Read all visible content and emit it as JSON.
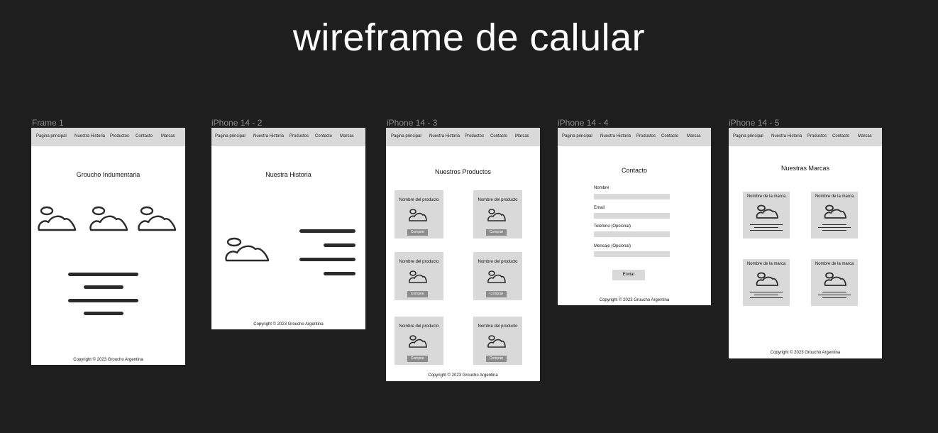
{
  "canvas_title": "wireframe de calular",
  "nav_items": [
    "Pagina principal",
    "Nuestra Historia",
    "Productos",
    "Contacto",
    "Marcas"
  ],
  "copyright": "Copyright © 2023 Groucho Argentina",
  "frames": {
    "f1": {
      "label": "Frame 1",
      "title": "Groucho Indumentaria"
    },
    "f2": {
      "label": "iPhone 14 - 2",
      "title": "Nuestra Historia"
    },
    "f3": {
      "label": "iPhone 14 - 3",
      "title": "Nuestros Productos",
      "product_name": "Nombre del producto",
      "buy_label": "Comprar"
    },
    "f4": {
      "label": "iPhone 14 - 4",
      "title": "Contacto",
      "fields": [
        "Nombre",
        "Email",
        "Telefono (Opcional)",
        "Mensaje (Opcional)"
      ],
      "send_label": "Enviar"
    },
    "f5": {
      "label": "iPhone 14 - 5",
      "title": "Nuestras Marcas",
      "brand_name": "Nombre de la marca"
    }
  },
  "colors": {
    "background": "#1e1e1e",
    "nav": "#d9d9d9",
    "card": "#d9d9d9",
    "button": "#8c8c8c",
    "ink": "#2b2b2b"
  },
  "icons": {
    "image_placeholder": "image-placeholder-icon"
  }
}
